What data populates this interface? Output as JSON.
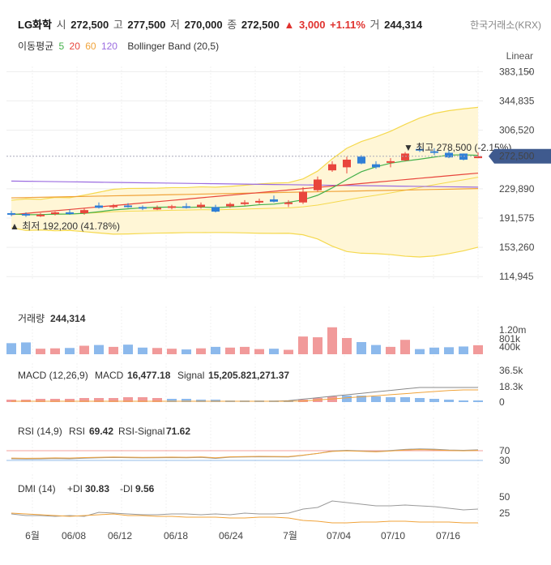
{
  "header": {
    "name": "LG화학",
    "open_label": "시",
    "open": "272,500",
    "high_label": "고",
    "high": "277,500",
    "low_label": "저",
    "low": "270,000",
    "close_label": "종",
    "close": "272,500",
    "change_arrow": "▲",
    "change": "3,000",
    "change_pct": "+1.11%",
    "volume_label": "거",
    "volume": "244,314",
    "exchange": "한국거래소(KRX)"
  },
  "legend": {
    "ma_label": "이동평균",
    "ma5": "5",
    "ma20": "20",
    "ma60": "60",
    "ma120": "120",
    "bb_label": "Bollinger Band (20,5)"
  },
  "scale_mode": "Linear",
  "scale_chevron": "chevron-down-icon",
  "colors": {
    "up": "#e8453c",
    "down": "#2f7fd6",
    "ma5": "#43b04a",
    "ma20": "#e8453c",
    "ma60": "#f0a33a",
    "ma120": "#9b6ce0",
    "band": "#f5d94e",
    "badge": "#3f5a8e"
  },
  "chart_data": [
    {
      "type": "candlestick",
      "name": "price",
      "x": [
        "06/03",
        "06/04",
        "06/05",
        "06/07",
        "06/10",
        "06/11",
        "06/12",
        "06/13",
        "06/14",
        "06/17",
        "06/18",
        "06/19",
        "06/20",
        "06/21",
        "06/24",
        "06/25",
        "06/26",
        "06/27",
        "06/28",
        "07/01",
        "07/02",
        "07/03",
        "07/04",
        "07/05",
        "07/08",
        "07/09",
        "07/10",
        "07/11",
        "07/12",
        "07/15",
        "07/16",
        "07/17",
        "07/18"
      ],
      "ohlc": [
        [
          198000,
          201000,
          194000,
          197000
        ],
        [
          197000,
          199000,
          193000,
          195000
        ],
        [
          195000,
          198000,
          193000,
          196000
        ],
        [
          197000,
          200000,
          195000,
          199000
        ],
        [
          199000,
          203000,
          196000,
          197000
        ],
        [
          198000,
          204000,
          196000,
          202000
        ],
        [
          208000,
          212000,
          204000,
          205000
        ],
        [
          206000,
          210000,
          204000,
          208000
        ],
        [
          208000,
          211000,
          205000,
          206000
        ],
        [
          206000,
          208000,
          202000,
          204000
        ],
        [
          204000,
          208000,
          202000,
          205000
        ],
        [
          205000,
          209000,
          203000,
          207000
        ],
        [
          207000,
          211000,
          204000,
          205000
        ],
        [
          206000,
          212000,
          204000,
          209000
        ],
        [
          206000,
          209000,
          199000,
          200000
        ],
        [
          207000,
          212000,
          205000,
          210000
        ],
        [
          210000,
          215000,
          208000,
          212000
        ],
        [
          212000,
          217000,
          210000,
          214000
        ],
        [
          216000,
          221000,
          212000,
          213000
        ],
        [
          210000,
          215000,
          206000,
          212000
        ],
        [
          212000,
          232000,
          210000,
          226000
        ],
        [
          228000,
          246000,
          226000,
          242000
        ],
        [
          254000,
          266000,
          252000,
          262000
        ],
        [
          258000,
          272000,
          250000,
          268000
        ],
        [
          272000,
          274000,
          262000,
          263000
        ],
        [
          262000,
          266000,
          256000,
          258000
        ],
        [
          264000,
          270000,
          258000,
          266000
        ],
        [
          267000,
          278000,
          266000,
          276000
        ],
        [
          282000,
          286000,
          278000,
          280000
        ],
        [
          279000,
          283000,
          274000,
          277000
        ],
        [
          277000,
          280000,
          270000,
          271000
        ],
        [
          276000,
          276000,
          267000,
          268000
        ],
        [
          270000,
          277500,
          270000,
          272500
        ]
      ],
      "ylim": [
        95000,
        390000
      ],
      "y_ticks": [
        "383,150",
        "344,835",
        "306,520",
        "229,890",
        "191,575",
        "153,260",
        "114,945"
      ],
      "current_price": "272,500",
      "max_marker": "▼ 최고 278,500 (-2.15%)",
      "min_marker": "▲ 최저 192,200 (41.78%)"
    },
    {
      "type": "bar",
      "name": "volume",
      "title": "거래량",
      "value_label": "244,314",
      "values": [
        300000,
        320000,
        150000,
        160000,
        170000,
        230000,
        250000,
        200000,
        260000,
        180000,
        170000,
        150000,
        130000,
        160000,
        200000,
        180000,
        200000,
        140000,
        150000,
        120000,
        480000,
        460000,
        730000,
        440000,
        330000,
        250000,
        200000,
        390000,
        140000,
        180000,
        190000,
        210000,
        244314
      ],
      "y_ticks": [
        "1.20m",
        "801k",
        "400k"
      ]
    },
    {
      "type": "line",
      "name": "macd",
      "title": "MACD (12,26,9)",
      "macd_label": "MACD",
      "macd_value": "16,477.18",
      "signal_label": "Signal",
      "signal_value": "15,205.821,271.37",
      "y_ticks": [
        "36.5k",
        "18.3k",
        "0"
      ]
    },
    {
      "type": "line",
      "name": "rsi",
      "title": "RSI (14,9)",
      "rsi_label": "RSI",
      "rsi_value": "69.42",
      "signal_label": "RSI-Signal",
      "signal_value": "71.62",
      "y_ticks": [
        "70",
        "30"
      ]
    },
    {
      "type": "line",
      "name": "dmi",
      "title": "DMI (14)",
      "pdi_label": "+DI",
      "pdi_value": "30.83",
      "mdi_label": "-DI",
      "mdi_value": "9.56",
      "y_ticks": [
        "50",
        "25"
      ],
      "x_ticks": [
        "6월",
        "06/08",
        "06/12",
        "06/18",
        "06/24",
        "7월",
        "07/04",
        "07/10",
        "07/16"
      ]
    }
  ]
}
